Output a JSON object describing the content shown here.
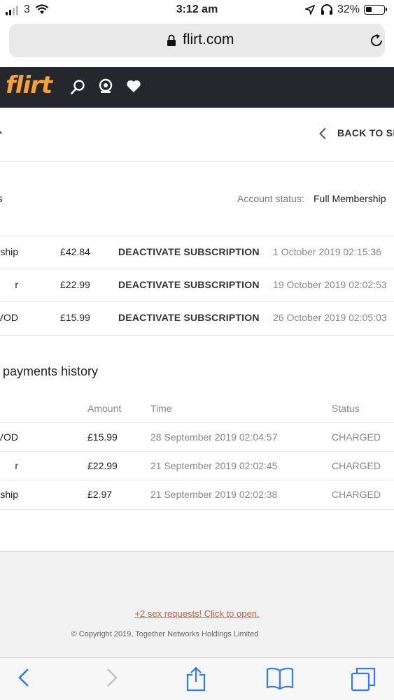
{
  "status_bar": {
    "carrier": "3",
    "time": "3:12 am",
    "battery": "32%"
  },
  "browser": {
    "url": "flirt.com"
  },
  "site": {
    "logo": "flirt"
  },
  "nav": {
    "back_label": "BACK TO SEA"
  },
  "subscriptions": {
    "title": "s",
    "account_status_label": "Account status:",
    "account_status_value": "Full Membership",
    "rows": [
      {
        "name": "bership",
        "amount": "£42.84",
        "action": "DEACTIVATE SUBSCRIPTION",
        "date": "1 October 2019 02:15:36"
      },
      {
        "name": "r",
        "amount": "£22.99",
        "action": "DEACTIVATE SUBSCRIPTION",
        "date": "19 October 2019 02:02:53"
      },
      {
        "name": "ss to VOD",
        "amount": "£15.99",
        "action": "DEACTIVATE SUBSCRIPTION",
        "date": "26 October 2019 02:05:03"
      }
    ]
  },
  "payments": {
    "title": "payments history",
    "headers": {
      "amount": "Amount",
      "time": "Time",
      "status": "Status"
    },
    "rows": [
      {
        "name": "ss to VOD",
        "amount": "£15.99",
        "time": "28 September 2019 02:04:57",
        "status": "CHARGED"
      },
      {
        "name": "r",
        "amount": "£22.99",
        "time": "21 September 2019 02:02:45",
        "status": "CHARGED"
      },
      {
        "name": "ship",
        "amount": "£2.97",
        "time": "21 September 2019 02:02:38",
        "status": "CHARGED"
      }
    ]
  },
  "footer": {
    "promo": "+2 sex requests! Click to open.",
    "copyright": "© Copyright 2019, Together Networks Holdings Limited"
  },
  "icons": {
    "search": "search-icon",
    "webcam": "webcam-icon",
    "favorites": "heart-icon",
    "back": "chevron-left-icon",
    "forward": "chevron-right-icon",
    "share": "share-icon",
    "bookmarks": "book-icon",
    "tabs": "tabs-icon",
    "reload": "reload-icon",
    "lock": "lock-icon"
  },
  "colors": {
    "header_bg": "#26272c",
    "logo": "#f6a238",
    "promo": "#e2583a",
    "ios_blue": "#2f7cf6"
  }
}
